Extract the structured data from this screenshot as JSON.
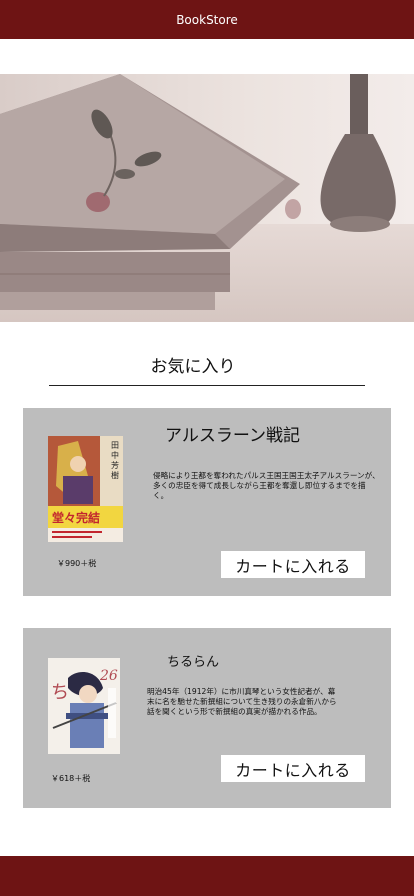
{
  "app": {
    "title": "BookStore"
  },
  "hero": {
    "image": "book-rose-vase-photo"
  },
  "favorites": {
    "heading": "お気に入り",
    "books": [
      {
        "title": "アルスラーン戦記",
        "description": "侵略により王都を奪われたパルス王国王国王太子アルスラーンが、　多くの忠臣を得て成長しながら王都を奪還し即位するまでを描く。",
        "price": "￥990＋税",
        "cart_label": "カートに入れる",
        "cover": "arslan-senki-cover"
      },
      {
        "title": "ちるらん",
        "description": "明治45年（1912年）に市川真琴という女性記者が、幕末に名を馳せた新撰組について生き残りの永倉新八から話を聞くという形で新撰組の真実が描かれる作品。",
        "price": "￥618＋税",
        "cart_label": "カートに入れる",
        "cover": "chiruran-cover"
      }
    ]
  }
}
